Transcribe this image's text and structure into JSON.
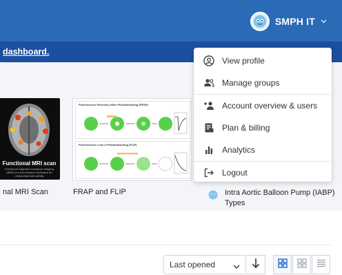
{
  "header": {
    "user_name": "SMPH IT",
    "banner_link": "dashboard."
  },
  "user_menu": {
    "items": [
      {
        "label": "View profile",
        "icon": "user-circle-icon"
      },
      {
        "label": "Manage groups",
        "icon": "users-icon"
      },
      {
        "label": "Account overview & users",
        "icon": "add-user-icon"
      },
      {
        "label": "Plan & billing",
        "icon": "receipt-icon"
      },
      {
        "label": "Analytics",
        "icon": "bar-chart-icon"
      },
      {
        "label": "Logout",
        "icon": "logout-icon"
      }
    ]
  },
  "cards": [
    {
      "label": "nal MRI Scan",
      "image_title": "Functional MRI scan",
      "image_subtitle": "Functional magnetic resonance imaging (fMRI) is a non-invasive technique for measuring brain activity"
    },
    {
      "label": "FRAP and FLIP",
      "panel_titles": [
        "Fluorescence Recovery After Photobleaching (FRAP)",
        "Fluorescence Loss in Photobleaching (FLIP)"
      ]
    },
    {
      "label": "Intra Aortic Balloon Pump (IABP) Types"
    }
  ],
  "toolbar": {
    "sort_value": "Last opened",
    "views": [
      "grid-large-icon",
      "grid-small-icon",
      "list-icon"
    ]
  },
  "colors": {
    "header_blue": "#2b6bb5",
    "banner_blue": "#1d4fa0",
    "accent": "#2f6fcf"
  }
}
